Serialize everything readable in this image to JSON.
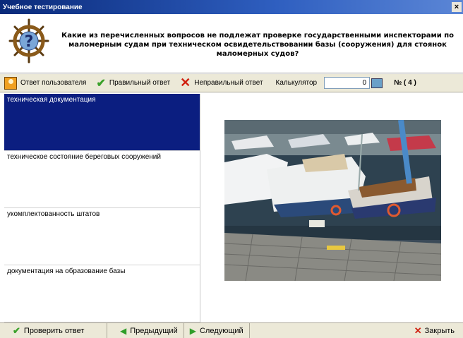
{
  "window": {
    "title": "Учебное тестирование",
    "close_glyph": "×"
  },
  "question": {
    "text": "Какие из перечисленных вопросов не подлежат проверке государственными инспекторами по маломерным судам при техническом освидетельствовании базы (сооружения) для стоянок маломерных судов?"
  },
  "toolbar": {
    "user_answer_label": "Ответ пользователя",
    "correct_answer_label": "Правильный ответ",
    "wrong_answer_label": "Неправильный ответ",
    "calculator_label": "Калькулятор",
    "calculator_value": "0",
    "question_number": "№ ( 4 )"
  },
  "answers": [
    {
      "label": "техническая документация",
      "selected": true
    },
    {
      "label": "техническое состояние береговых сооружений",
      "selected": false
    },
    {
      "label": "укомплектованность штатов",
      "selected": false
    },
    {
      "label": "документация на образование базы",
      "selected": false
    }
  ],
  "bottom": {
    "check_label": "Проверить ответ",
    "prev_label": "Предыдущий",
    "next_label": "Следующий",
    "close_label": "Закрыть"
  },
  "colors": {
    "selection": "#0b1e80",
    "titlebar": "#0a2a7a",
    "panel": "#ece9d8"
  }
}
